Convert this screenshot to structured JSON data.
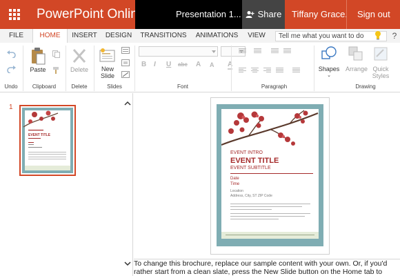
{
  "app": {
    "name": "PowerPoint Online",
    "document_title": "Presentation 1...",
    "share_label": "Share",
    "user_name": "Tiffany Grace...",
    "sign_out": "Sign out",
    "brand_color": "#d24726"
  },
  "tabs": [
    {
      "label": "FILE"
    },
    {
      "label": "HOME",
      "active": true
    },
    {
      "label": "INSERT"
    },
    {
      "label": "DESIGN"
    },
    {
      "label": "TRANSITIONS"
    },
    {
      "label": "ANIMATIONS"
    },
    {
      "label": "VIEW"
    }
  ],
  "tell_me": {
    "placeholder": "Tell me what you want to do",
    "help": "?"
  },
  "ribbon": {
    "undo_group": "Undo",
    "clipboard_group": "Clipboard",
    "paste": "Paste",
    "delete_group": "Delete",
    "delete": "Delete",
    "slides_group": "Slides",
    "new_slide_line1": "New",
    "new_slide_line2": "Slide",
    "font_group": "Font",
    "paragraph_group": "Paragraph",
    "drawing_group": "Drawing",
    "shapes": "Shapes",
    "arrange": "Arrange",
    "quick_styles_line1": "Quick",
    "quick_styles_line2": "Styles",
    "font_buttons": [
      "B",
      "I",
      "U",
      "abc",
      "A",
      "A",
      "A"
    ]
  },
  "thumbnails": {
    "slide_number": "1",
    "thumb_title": "EVENT TITLE"
  },
  "slide": {
    "intro": "EVENT INTRO",
    "title": "EVENT TITLE",
    "subtitle": "EVENT SUBTITLE",
    "date_label": "Date",
    "time_label": "Time",
    "location_line": "Location",
    "address_line": "Address, City, ST ZIP Code",
    "frame_color": "#7fadb3",
    "title_color": "#a52a2a"
  },
  "notes": {
    "text": "To change this brochure, replace our sample content with your own. Or, if you'd rather start from a clean slate, press the New Slide button on the Home tab to"
  }
}
